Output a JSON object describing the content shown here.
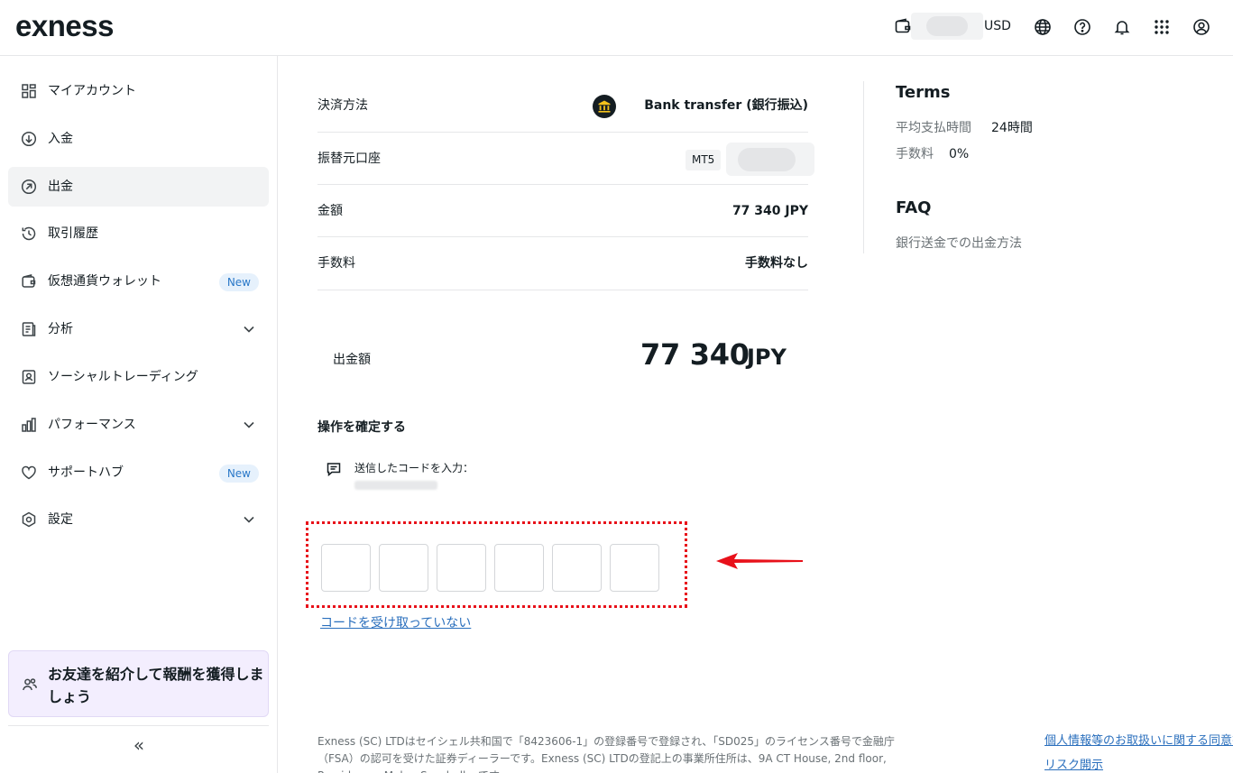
{
  "header": {
    "logo": "exness",
    "currency": "USD",
    "icons": [
      "wallet-icon",
      "globe-icon",
      "help-icon",
      "bell-icon",
      "apps-icon",
      "user-icon"
    ]
  },
  "sidebar": {
    "items": [
      {
        "label": "マイアカウント",
        "icon": "grid-icon"
      },
      {
        "label": "入金",
        "icon": "deposit-icon"
      },
      {
        "label": "出金",
        "icon": "withdraw-icon",
        "active": true
      },
      {
        "label": "取引履歴",
        "icon": "history-icon"
      },
      {
        "label": "仮想通貨ウォレット",
        "icon": "wallet-icon",
        "badge": "New"
      },
      {
        "label": "分析",
        "icon": "analysis-icon",
        "expandable": true
      },
      {
        "label": "ソーシャルトレーディング",
        "icon": "social-trading-icon"
      },
      {
        "label": "パフォーマンス",
        "icon": "bar-chart-icon",
        "expandable": true
      },
      {
        "label": "サポートハブ",
        "icon": "heart-icon",
        "badge": "New"
      },
      {
        "label": "設定",
        "icon": "settings-icon",
        "expandable": true
      }
    ],
    "promo": "お友達を紹介して報酬を獲得しましょう",
    "collapse": "«"
  },
  "details": {
    "payment_method_label": "決済方法",
    "payment_method_value": "Bank transfer (銀行振込)",
    "source_account_label": "振替元口座",
    "source_account_platform": "MT5",
    "amount_label": "金額",
    "amount_value": "77 340 JPY",
    "fee_label": "手数料",
    "fee_value": "手数料なし"
  },
  "total": {
    "label": "出金額",
    "amount": "77 340",
    "currency": "JPY"
  },
  "confirm": {
    "title": "操作を確定する",
    "sms_text": "送信したコードを入力：",
    "code_length": 6,
    "resend_link": "コードを受け取っていない",
    "highlight_color": "#e8111a"
  },
  "terms": {
    "title": "Terms",
    "processing_time_label": "平均支払時間",
    "processing_time_value": "24時間",
    "fee_label": "手数料",
    "fee_value": "0%"
  },
  "faq": {
    "title": "FAQ",
    "link": "銀行送金での出金方法"
  },
  "footer": {
    "legal_text": "Exness (SC) LTDはセイシェル共和国で「8423606-1」の登録番号で登録され、「SD025」のライセンス番号で金融庁（FSA）の認可を受けた証券ディーラーです。Exness (SC) LTDの登記上の事業所住所は、9A CT House, 2nd floor, Providence, Mahe, Seychellesです。",
    "privacy_link": "個人情報等のお取扱いに関する同意書",
    "risk_link": "リスク開示"
  }
}
